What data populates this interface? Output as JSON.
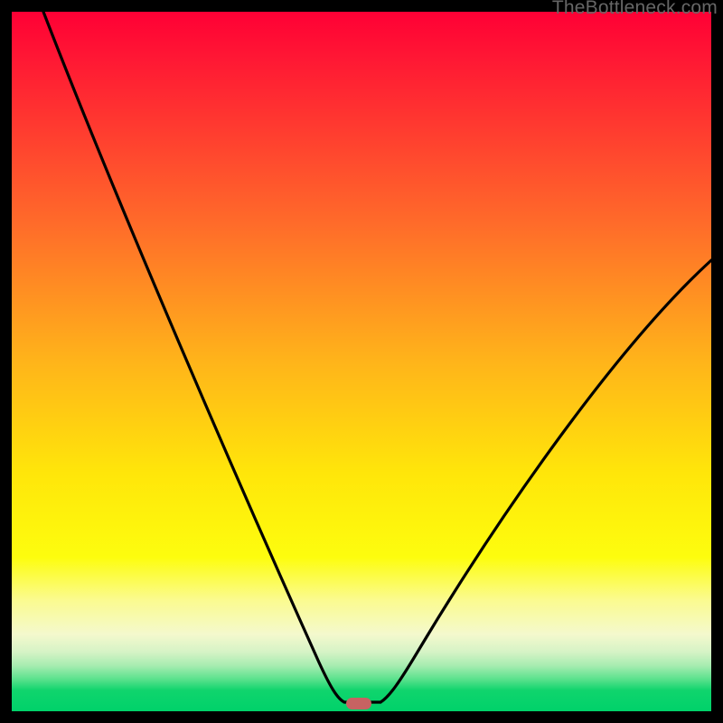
{
  "watermark": "TheBottleneck.com",
  "colors": {
    "frame": "#000000",
    "curve": "#000000",
    "marker": "#c76262",
    "gradient_top": "#ff0035",
    "gradient_mid": "#ffe60a",
    "gradient_bottom": "#00d26a"
  },
  "chart_data": {
    "type": "line",
    "title": "",
    "xlabel": "",
    "ylabel": "",
    "xlim": [
      0,
      100
    ],
    "ylim": [
      0,
      100
    ],
    "series": [
      {
        "name": "bottleneck-curve",
        "x": [
          5,
          10,
          15,
          20,
          25,
          30,
          35,
          40,
          43,
          46,
          48,
          50,
          52,
          55,
          60,
          65,
          70,
          75,
          80,
          85,
          90,
          95,
          100
        ],
        "y": [
          100,
          88,
          76,
          64,
          52,
          40,
          28,
          15,
          6,
          1,
          0,
          0,
          0,
          2,
          8,
          14,
          21,
          28,
          35,
          42,
          49,
          56,
          64
        ]
      }
    ],
    "annotations": [
      {
        "name": "optimal-marker",
        "x": 49,
        "y": 0.5
      }
    ]
  }
}
